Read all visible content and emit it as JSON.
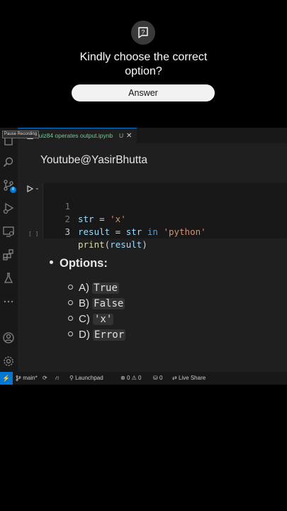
{
  "quiz": {
    "prompt_line1": "Kindly choose the correct",
    "prompt_line2": "option?",
    "answer_label": "Answer",
    "icon": "question-icon"
  },
  "vscode": {
    "recording_tooltip": "Pause Recording",
    "tab": {
      "title": "quiz84 operates output.ipynb",
      "modified_marker": "U",
      "close_glyph": "✕"
    },
    "activity_bar": {
      "icons": [
        "explorer-icon",
        "search-icon",
        "source-control-icon",
        "run-debug-icon",
        "remote-explorer-icon",
        "extensions-icon",
        "testing-icon",
        "more-icon",
        "account-icon",
        "settings-icon"
      ],
      "source_control_badge": "8"
    },
    "watermark": "Youtube@YasirBhutta",
    "cell": {
      "execution_count": "[ ]",
      "lines": [
        {
          "number": "1",
          "text": "str = 'x'"
        },
        {
          "number": "2",
          "text": "result = str in 'python'"
        },
        {
          "number": "3",
          "text": "print(result)"
        }
      ]
    },
    "options": {
      "heading": "Options:",
      "items": [
        {
          "letter": "A)",
          "value": "True"
        },
        {
          "letter": "B)",
          "value": "False"
        },
        {
          "letter": "C)",
          "value": "'x'"
        },
        {
          "letter": "D)",
          "value": "Error"
        }
      ]
    },
    "status_bar": {
      "branch": "main*",
      "launchpad": "Launchpad",
      "errors": "0",
      "warnings": "0",
      "ports": "0",
      "live_share": "Live Share"
    }
  },
  "colors": {
    "accent": "#0078d4",
    "untracked_file": "#73c991",
    "string": "#ce9178",
    "keyword": "#569cd6",
    "variable": "#9cdcfe",
    "function": "#dcdcaa"
  }
}
